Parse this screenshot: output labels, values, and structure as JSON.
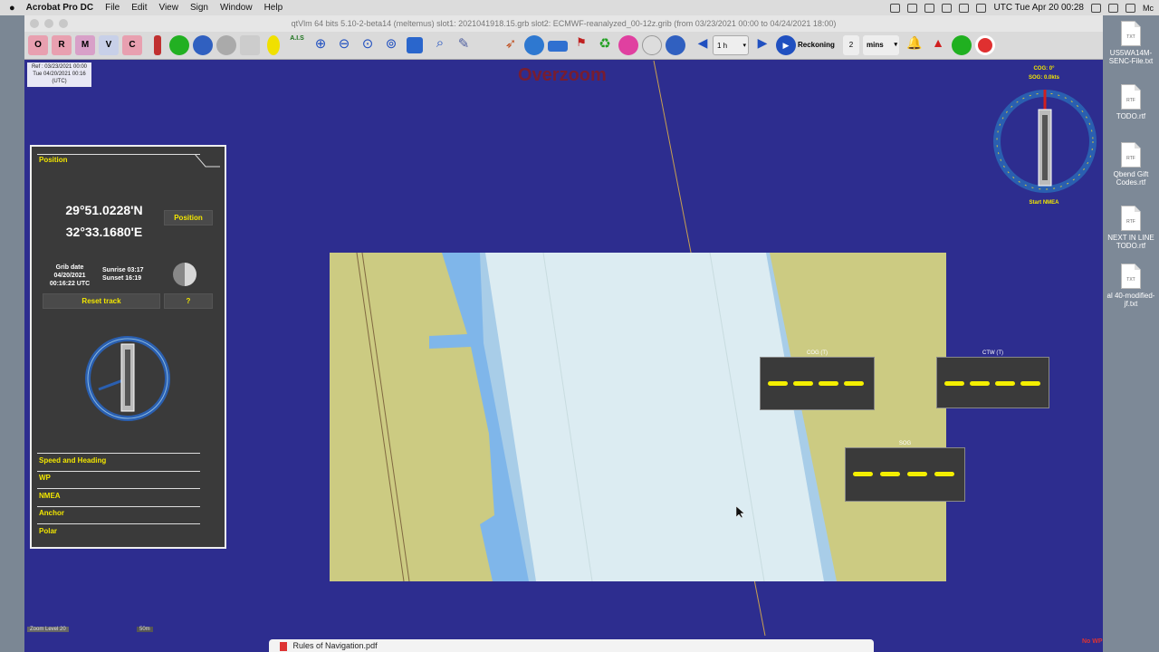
{
  "menubar": {
    "app": "Acrobat Pro DC",
    "items": [
      "File",
      "Edit",
      "View",
      "Sign",
      "Window",
      "Help"
    ],
    "clock": "UTC Tue Apr 20 00:28"
  },
  "window": {
    "title": "qtVlm 64 bits 5.10-2-beta14 (meltemus) slot1: 2021041918.15.grb slot2: ECMWF-reanalyzed_00-12z.grib (from 03/23/2021 00:00 to 04/24/2021 18:00)"
  },
  "toolbar": {
    "interval": "1 h",
    "reckoning_label": "Reckoning",
    "reckoning_value": "2",
    "reckoning_unit": "mins",
    "ais_label": "A.I.S"
  },
  "overlay": {
    "overzoom": "Overzoom",
    "ref_line1": "Ref : 03/23/2021 00:00",
    "ref_line2": "Tue 04/20/2021 00:16",
    "ref_line3": "(UTC)"
  },
  "dashboard": {
    "position_header": "Position",
    "lat": "29°51.0228'N",
    "lon": "32°33.1680'E",
    "position_button": "Position",
    "grib_date_label": "Grib date",
    "grib_date": "04/20/2021",
    "grib_time": "00:16:22 UTC",
    "sunrise": "Sunrise 03:17",
    "sunset": "Sunset  16:19",
    "reset_track": "Reset track",
    "help": "?",
    "sections": [
      "Speed and Heading",
      "WP",
      "NMEA",
      "Anchor",
      "Polar"
    ]
  },
  "instruments": {
    "cog": "COG (T)",
    "ctw": "CTW (T)",
    "sog": "SOG"
  },
  "compass": {
    "cog": "COG: 0°",
    "sog": "SOG: 0.0kts",
    "start": "Start NMEA"
  },
  "status": {
    "zoom_level": "Zoom Level 20",
    "scale": "50m",
    "no_wp": "No WP"
  },
  "dock": {
    "file": "Rules of Navigation.pdf"
  },
  "desktop": {
    "files": [
      {
        "name": "US5WA14M-SENC-File.txt",
        "ext": "TXT"
      },
      {
        "name": "TODO.rtf",
        "ext": "RTF"
      },
      {
        "name": "Qbend Gift Codes.rtf",
        "ext": "RTF"
      },
      {
        "name": "NEXT IN LINE TODO.rtf",
        "ext": "RTF"
      },
      {
        "name": "al 40-modified-jf.txt",
        "ext": "TXT"
      }
    ]
  }
}
